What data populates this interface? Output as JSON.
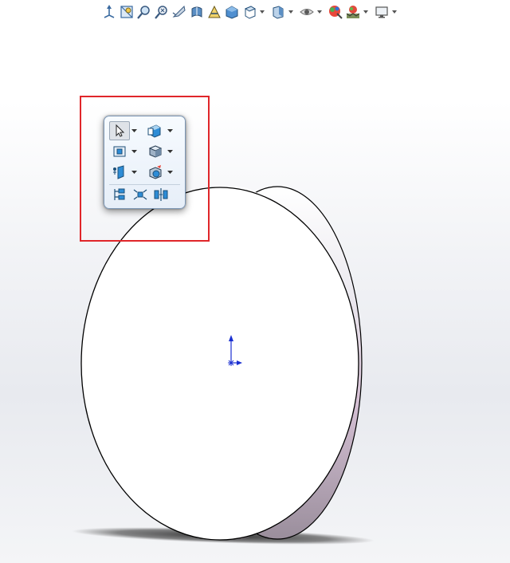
{
  "app": {
    "canvas_background": "#ffffff",
    "accent_red": "#e0262a",
    "triad_color": "#1a2fd1"
  },
  "hud_toolbar": {
    "items": [
      {
        "icon": "view-orientation-icon"
      },
      {
        "icon": "zoom-to-area-icon"
      },
      {
        "icon": "zoom-in-out-icon"
      },
      {
        "icon": "zoom-to-fit-icon"
      },
      {
        "icon": "rotate-view-icon"
      },
      {
        "icon": "section-view-icon"
      },
      {
        "icon": "dynamic-annotation-icon"
      },
      {
        "icon": "standard-view-cube-icon"
      },
      {
        "icon": "display-style-icon",
        "has_dropdown": true
      },
      {
        "icon": "hide-show-items-icon",
        "has_dropdown": true
      },
      {
        "icon": "visibility-eye-icon",
        "has_dropdown": true
      },
      {
        "icon": "edit-appearance-icon"
      },
      {
        "icon": "apply-scene-icon",
        "has_dropdown": true
      },
      {
        "icon": "view-settings-monitor-icon",
        "has_dropdown": true
      }
    ]
  },
  "context_toolbar": {
    "rows": [
      [
        {
          "icon": "select-arrow-icon",
          "selected": true
        },
        {
          "icon": "view-orientation-cube-icon"
        }
      ],
      [
        {
          "icon": "normal-to-icon"
        },
        {
          "icon": "display-style-cube-icon"
        }
      ],
      [
        {
          "icon": "hide-show-plane-icon"
        },
        {
          "icon": "appearance-cube-icon"
        }
      ],
      [
        {
          "icon": "feature-tree-expand-icon"
        },
        {
          "icon": "configuration-explode-icon"
        },
        {
          "icon": "mirror-mate-icon"
        }
      ]
    ]
  }
}
